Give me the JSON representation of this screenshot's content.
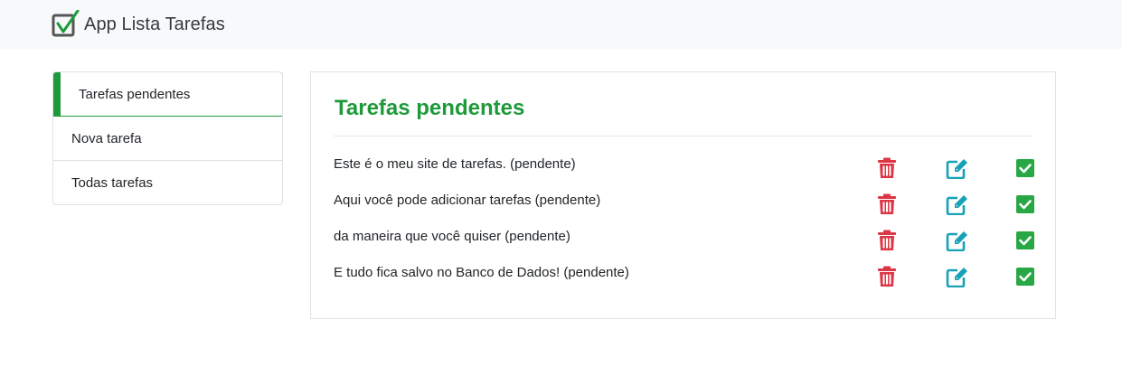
{
  "app": {
    "title": "App Lista Tarefas",
    "logo_icon": "checkbox-check-icon"
  },
  "sidebar": {
    "items": [
      {
        "label": "Tarefas pendentes",
        "active": true
      },
      {
        "label": "Nova tarefa",
        "active": false
      },
      {
        "label": "Todas tarefas",
        "active": false
      }
    ]
  },
  "main": {
    "title": "Tarefas pendentes",
    "tasks": [
      {
        "text": "Este é o meu site de tarefas. (pendente)"
      },
      {
        "text": "Aqui você pode adicionar tarefas (pendente)"
      },
      {
        "text": "da maneira que você quiser (pendente)"
      },
      {
        "text": "E tudo fica salvo no Banco de Dados! (pendente)"
      }
    ],
    "actions": {
      "delete_icon": "trash-icon",
      "edit_icon": "edit-icon",
      "done_icon": "check-square-icon"
    }
  },
  "colors": {
    "accent": "#1e9a3a",
    "danger": "#dc3545",
    "info": "#17a2b8",
    "success": "#28a745"
  }
}
